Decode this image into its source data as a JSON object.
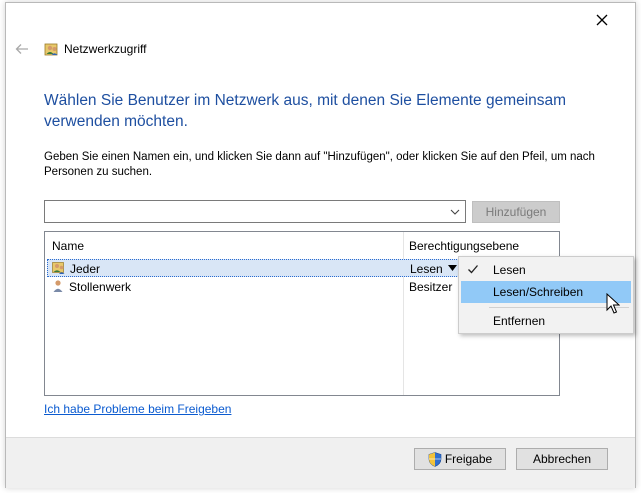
{
  "window": {
    "title": "Netzwerkzugriff",
    "close_label": "×"
  },
  "main": {
    "headline": "Wählen Sie Benutzer im Netzwerk aus, mit denen Sie Elemente gemeinsam verwenden möchten.",
    "description": "Geben Sie einen Namen ein, und klicken Sie dann auf \"Hinzufügen\", oder klicken Sie auf den Pfeil, um nach Personen zu suchen.",
    "name_input": {
      "value": "",
      "placeholder": ""
    },
    "add_button_label": "Hinzufügen",
    "add_button_enabled": false,
    "columns": [
      "Name",
      "Berechtigungsebene"
    ],
    "rows": [
      {
        "name": "Jeder",
        "permission": "Lesen",
        "icon": "users-group-icon",
        "selected": true
      },
      {
        "name": "Stollenwerk",
        "permission": "Besitzer",
        "icon": "user-icon",
        "selected": false
      }
    ],
    "help_link": "Ich habe Probleme beim Freigeben"
  },
  "context_menu": {
    "items": [
      {
        "label": "Lesen",
        "checked": true
      },
      {
        "label": "Lesen/Schreiben",
        "highlighted": true
      },
      {
        "label": "Entfernen"
      }
    ]
  },
  "footer": {
    "share_label": "Freigabe",
    "cancel_label": "Abbrechen"
  },
  "colors": {
    "headline": "#1e4fa0",
    "link": "#0b5bd0",
    "selection": "#d9e6f6",
    "menu_highlight": "#91c9f7"
  }
}
